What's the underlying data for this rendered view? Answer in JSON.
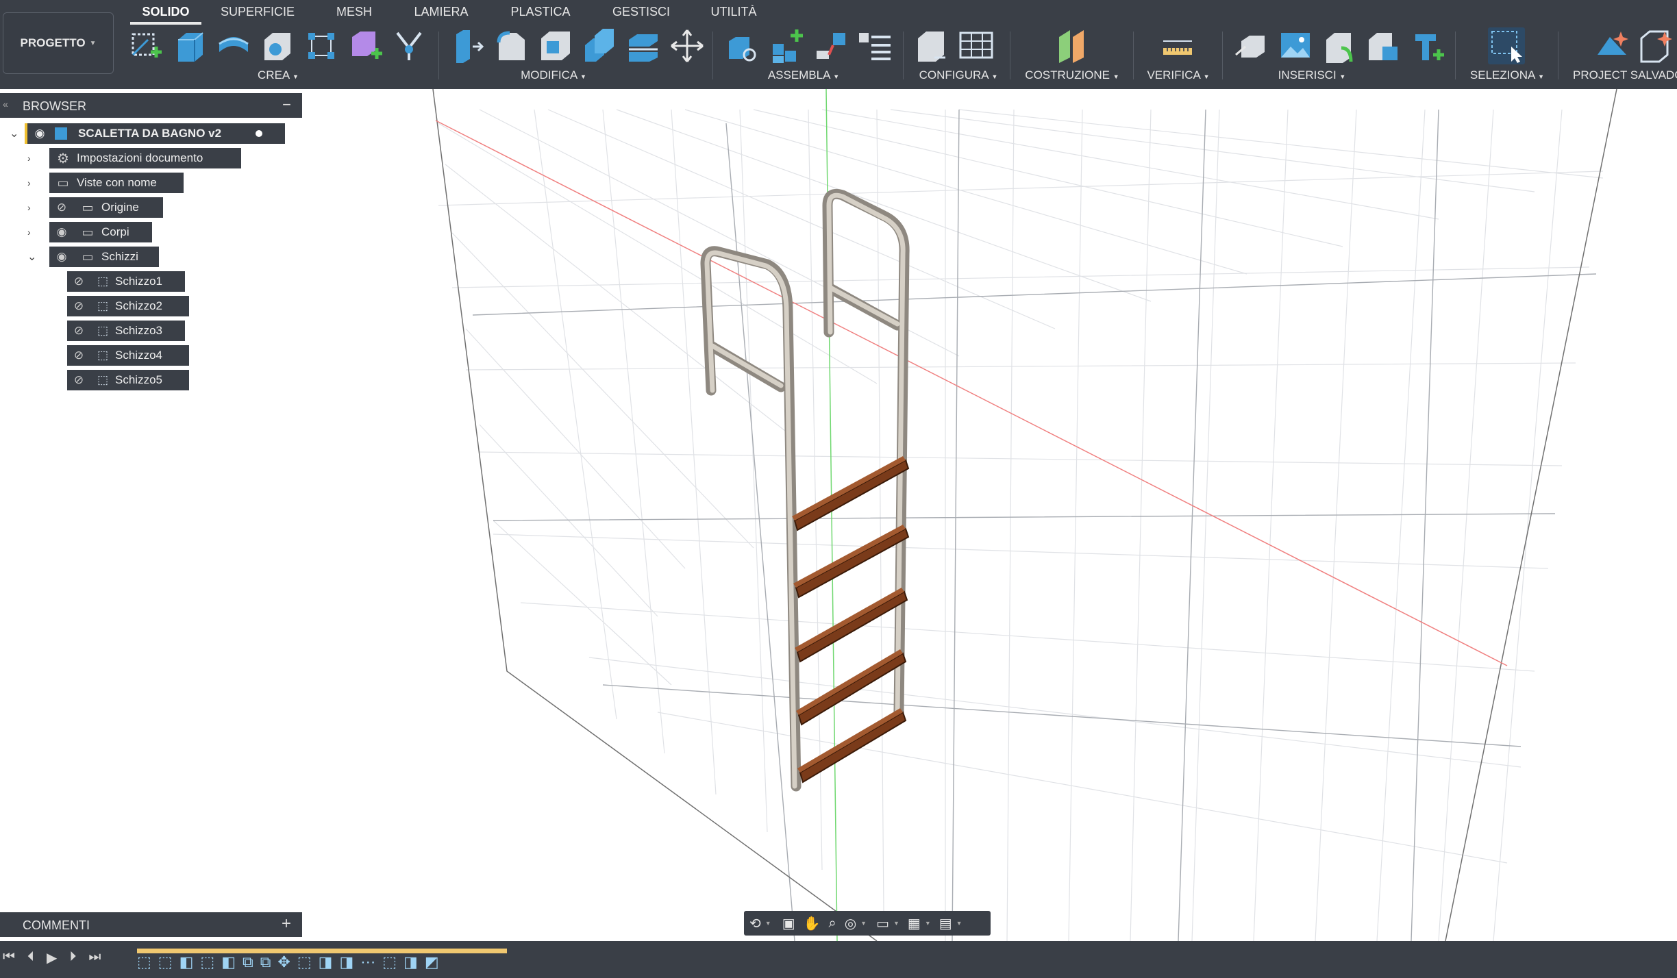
{
  "project_button": {
    "label": "PROGETTO"
  },
  "tabs": [
    {
      "label": "SOLIDO",
      "active": true
    },
    {
      "label": "SUPERFICIE"
    },
    {
      "label": "MESH"
    },
    {
      "label": "LAMIERA"
    },
    {
      "label": "PLASTICA"
    },
    {
      "label": "GESTISCI"
    },
    {
      "label": "UTILITÀ"
    }
  ],
  "toolbar_groups": {
    "crea": "CREA",
    "modifica": "MODIFICA",
    "assembla": "ASSEMBLA",
    "configura": "CONFIGURA",
    "costruzione": "COSTRUZIONE",
    "verifica": "VERIFICA",
    "inserisci": "INSERISCI",
    "seleziona": "SELEZIONA",
    "project_salvado": "PROJECT SALVADO"
  },
  "browser": {
    "title": "BROWSER",
    "root": "SCALETTA DA BAGNO v2",
    "items": [
      {
        "label": "Impostazioni documento"
      },
      {
        "label": "Viste con nome"
      },
      {
        "label": "Origine"
      },
      {
        "label": "Corpi"
      },
      {
        "label": "Schizzi"
      }
    ],
    "sketches": [
      "Schizzo1",
      "Schizzo2",
      "Schizzo3",
      "Schizzo4",
      "Schizzo5"
    ]
  },
  "comments": {
    "title": "COMMENTI"
  },
  "colors": {
    "toolbar_bg": "#3a3f47",
    "accent": "#3d9ad6",
    "step_wood": "#7a3b1a",
    "rail_metal": "#b8b2a8",
    "axis_red": "#e05050",
    "axis_green": "#4cc44c"
  }
}
